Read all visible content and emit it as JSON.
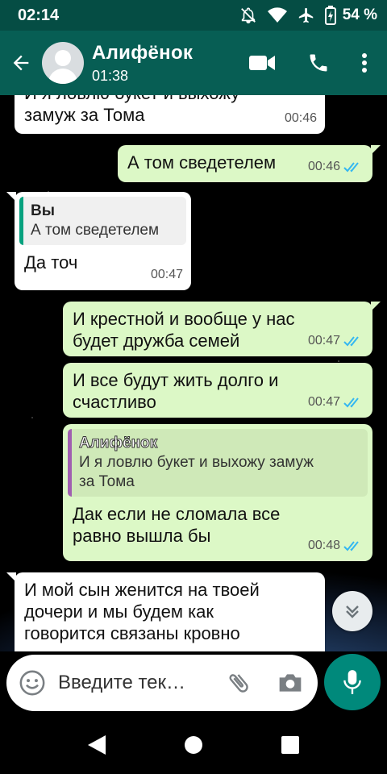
{
  "status_bar": {
    "time": "02:14",
    "battery_percent": "54 %",
    "icons": [
      "mute-icon",
      "wifi-icon",
      "airplane-icon",
      "battery-charging-icon"
    ]
  },
  "header": {
    "contact_name": "Алифёнок",
    "subtitle": "01:38",
    "icons": [
      "back-arrow-icon",
      "avatar",
      "video-call-icon",
      "phone-icon",
      "more-vert-icon"
    ]
  },
  "messages": [
    {
      "direction": "in",
      "text": "И я ловлю букет и выхожу\nзамуж за Тома",
      "time": "00:46"
    },
    {
      "direction": "out",
      "text": "А том сведетелем",
      "time": "00:46",
      "read": true
    },
    {
      "direction": "in",
      "quote": {
        "author": "Вы",
        "text": "А том сведетелем"
      },
      "text": "Да точ",
      "time": "00:47"
    },
    {
      "direction": "out",
      "text": "И крестной и вообще у нас\nбудет дружба семей",
      "time": "00:47",
      "read": true
    },
    {
      "direction": "out",
      "text": "И все будут жить долго и\nсчастливо",
      "time": "00:47",
      "read": true
    },
    {
      "direction": "out",
      "quote": {
        "author": "Алифёнок",
        "text": "И я ловлю букет и выхожу замуж\nза Тома"
      },
      "text": "Дак если не сломала все\nравно вышла бы",
      "time": "00:48",
      "read": true
    },
    {
      "direction": "in",
      "text": "И мой сын женится на твоей\nдочери и мы будем как\nговорится связаны кровно",
      "time": ""
    }
  ],
  "composer": {
    "placeholder": "Введите тек…",
    "icons": [
      "emoji-icon",
      "attach-icon",
      "camera-icon",
      "mic-icon"
    ]
  },
  "colors": {
    "header_bg": "#075e54",
    "status_bg": "#054d44",
    "out_bubble": "#dcf8c6",
    "in_bubble": "#ffffff",
    "read_ticks": "#34b7f1",
    "fab": "#00897b",
    "quote_bar_self": "#06a27f",
    "quote_bar_other": "#a05fb0"
  },
  "nav_bar": {
    "icons": [
      "back-triangle-icon",
      "home-circle-icon",
      "recents-square-icon"
    ]
  }
}
